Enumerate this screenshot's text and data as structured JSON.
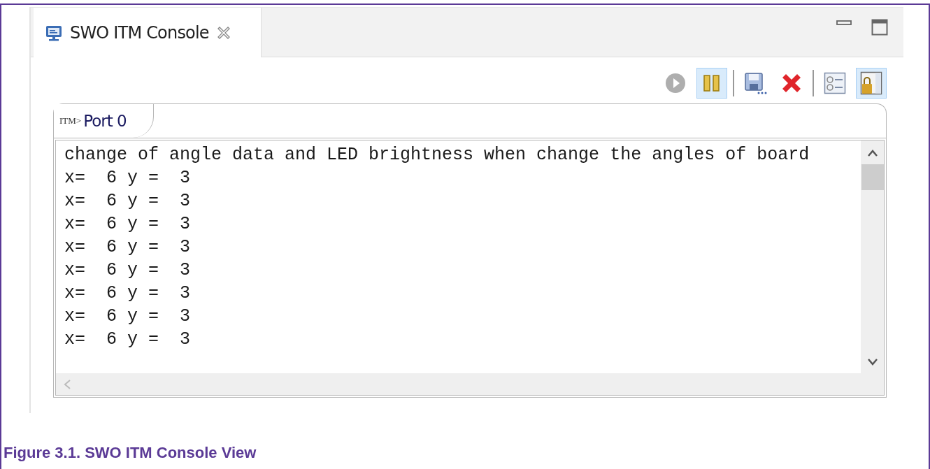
{
  "view_tab": {
    "title": "SWO ITM Console",
    "selected": true
  },
  "toolbar": [
    {
      "kind": "start",
      "disabled": true,
      "checked": false
    },
    {
      "kind": "pause",
      "disabled": false,
      "checked": true
    },
    {
      "kind": "separator"
    },
    {
      "kind": "save",
      "disabled": false,
      "checked": false
    },
    {
      "kind": "remove",
      "disabled": false,
      "checked": false
    },
    {
      "kind": "separator"
    },
    {
      "kind": "settings",
      "disabled": false,
      "checked": false
    },
    {
      "kind": "scroll-lock",
      "disabled": false,
      "checked": true
    }
  ],
  "port_tabs": [
    {
      "prefix": "ITM>",
      "label": "Port 0",
      "selected": true
    }
  ],
  "console": {
    "lines": [
      "change of angle data and LED brightness when change the angles of board",
      "x=  6 y =  3",
      "x=  6 y =  3",
      "x=  6 y =  3",
      "x=  6 y =  3",
      "x=  6 y =  3",
      "x=  6 y =  3",
      "x=  6 y =  3",
      "x=  6 y =  3"
    ]
  },
  "caption": "Figure 3.1. SWO ITM Console View"
}
